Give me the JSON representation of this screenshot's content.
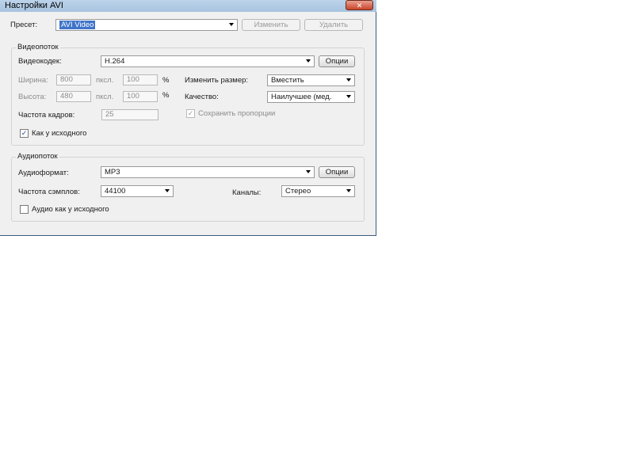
{
  "window": {
    "title": "Настройки AVI",
    "close_glyph": "✕"
  },
  "preset": {
    "label": "Пресет:",
    "value": "AVI Video",
    "edit_button": "Изменить",
    "delete_button": "Удалить"
  },
  "video": {
    "group_title": "Видеопоток",
    "codec_label": "Видеокодек:",
    "codec_value": "H.264",
    "options_button": "Опции",
    "width_label": "Ширина:",
    "width_value": "800",
    "width_unit": "пксл.",
    "width_percent": "100",
    "height_label": "Высота:",
    "height_value": "480",
    "height_unit": "пксл.",
    "height_percent": "100",
    "percent_sign": "%",
    "resize_label": "Изменить размер:",
    "resize_value": "Вместить",
    "quality_label": "Качество:",
    "quality_value": "Наилучшее (мед.",
    "fps_label": "Частота кадров:",
    "fps_value": "25",
    "keep_ratio_label": "Сохранить пропорции",
    "keep_ratio_checked": true,
    "as_source_label": "Как у исходного",
    "as_source_checked": true
  },
  "audio": {
    "group_title": "Аудиопоток",
    "format_label": "Аудиоформат:",
    "format_value": "MP3",
    "options_button": "Опции",
    "sample_rate_label": "Частота сэмплов:",
    "sample_rate_value": "44100",
    "channels_label": "Каналы:",
    "channels_value": "Стерео",
    "as_source_label": "Аудио как у исходного",
    "as_source_checked": false
  },
  "glyphs": {
    "check": "✓"
  }
}
